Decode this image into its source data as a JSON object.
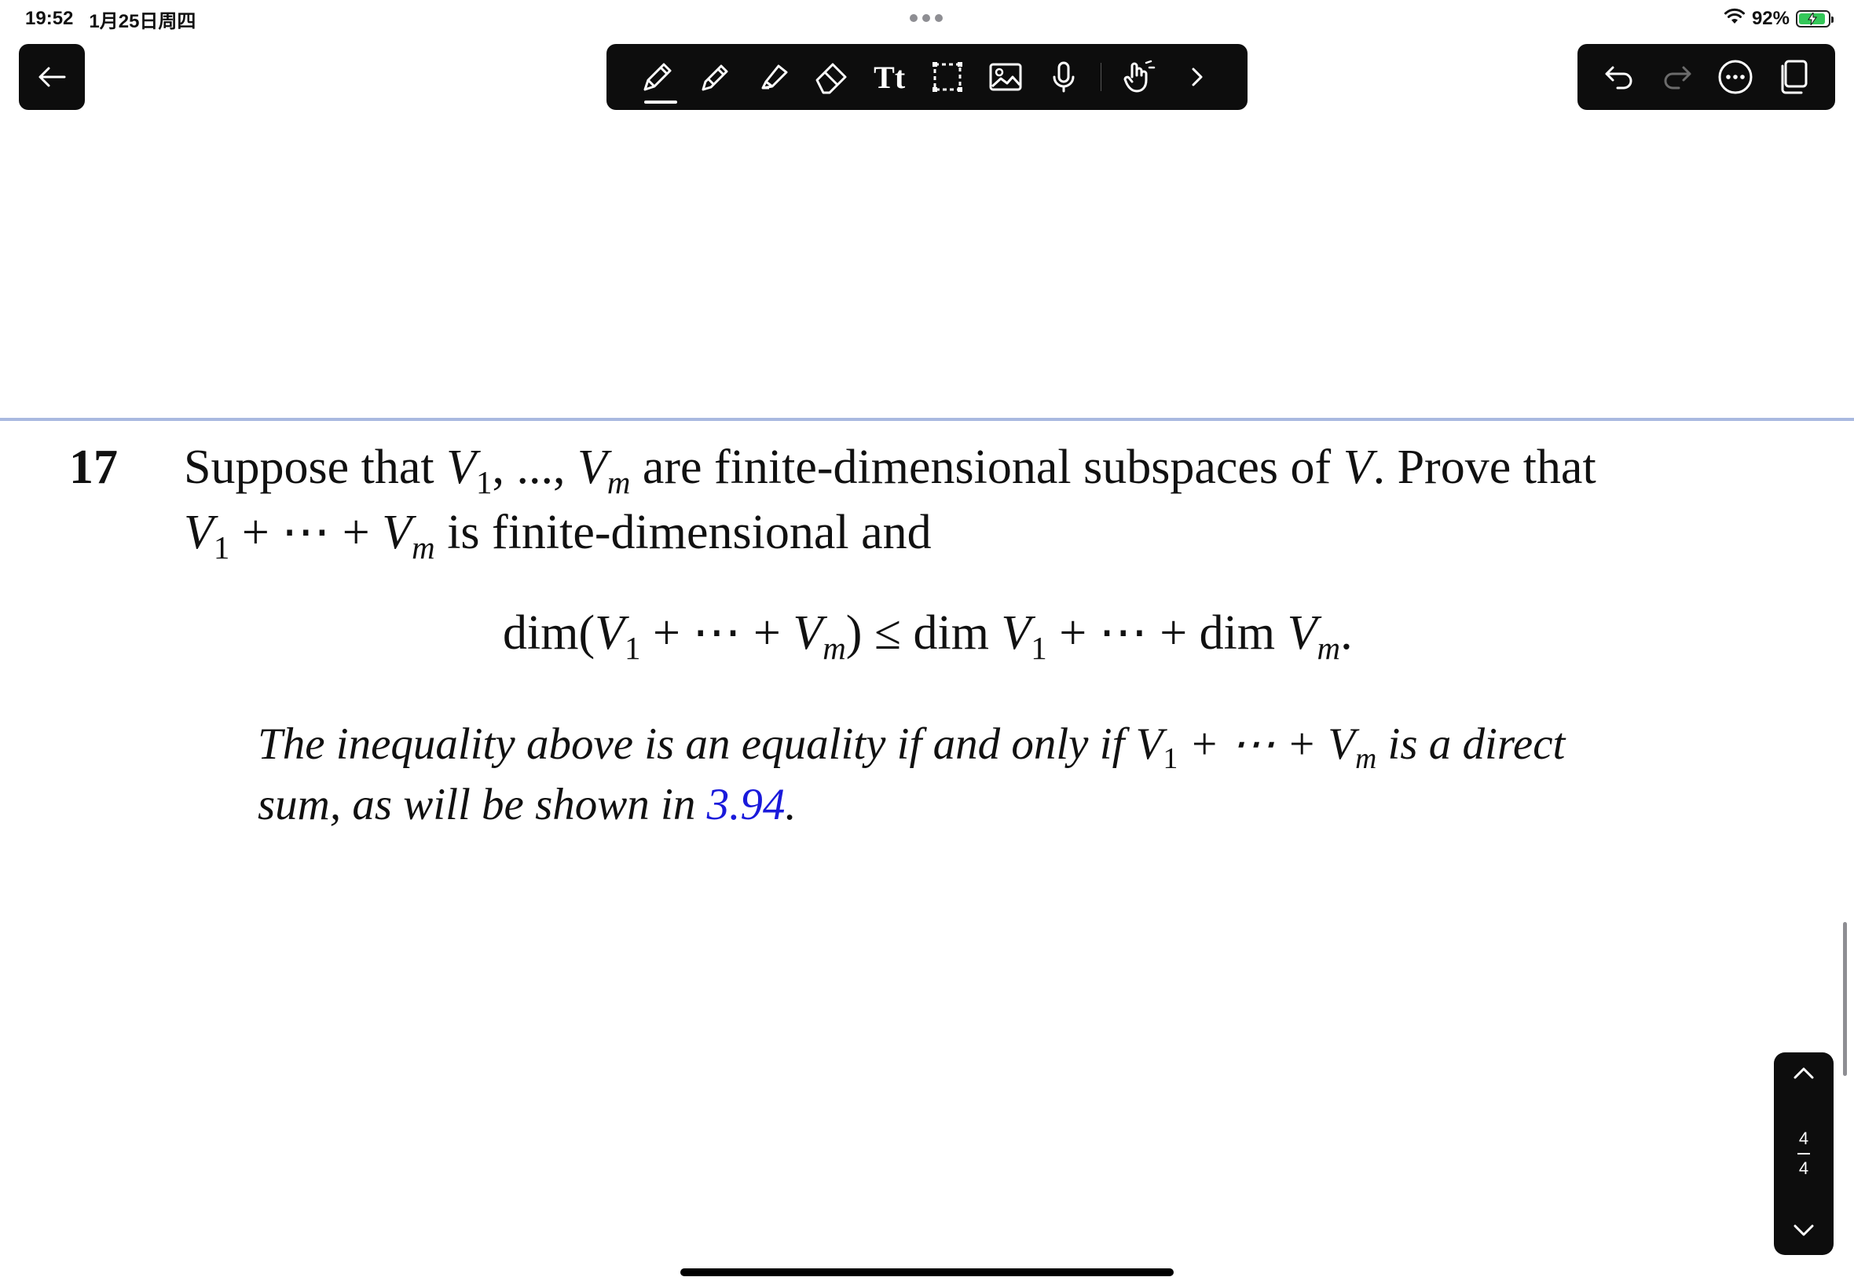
{
  "status_bar": {
    "time": "19:52",
    "date": "1月25日周四",
    "battery": "92%"
  },
  "colors": {
    "toolbar_bg": "#0d0d0d",
    "page_divider": "#a9b9e0",
    "link": "#1a1adb",
    "battery_fill": "#34c759"
  },
  "toolbar": {
    "tools": [
      "pen-tool-icon",
      "pencil-tool-icon",
      "highlighter-tool-icon",
      "eraser-tool-icon",
      "text-tool-icon",
      "lasso-select-icon",
      "image-insert-icon",
      "microphone-icon",
      "hand-gesture-icon",
      "chevron-right-icon"
    ],
    "text_tool_label": "Tt"
  },
  "document": {
    "problem_number": "17",
    "line1": {
      "t1": "Suppose that ",
      "v": "V",
      "s1": "1",
      "t2": ", ..., ",
      "sm": "m",
      "t3": " are finite-dimensional subspaces of ",
      "v_end": "V",
      "t4": ". Prove that"
    },
    "line2": {
      "s1": "1",
      "t1": " + ⋯ + ",
      "sm": "m",
      "t2": " is finite-dimensional and"
    },
    "equation": {
      "t1": "dim(",
      "s1": "1",
      "t2": " + ⋯ + ",
      "sm": "m",
      "t3": ") ≤ dim ",
      "t4": " + ⋯ + dim ",
      "t5": "."
    },
    "note": {
      "t1": "The inequality above is an equality if and only if ",
      "s1": "1",
      "t2": " + ⋯ + ",
      "sm": "m",
      "t3": " is a direct",
      "t4": "sum, as will be shown in ",
      "link": "3.94",
      "t5": "."
    }
  },
  "page_nav": {
    "current": "4",
    "total": "4"
  }
}
